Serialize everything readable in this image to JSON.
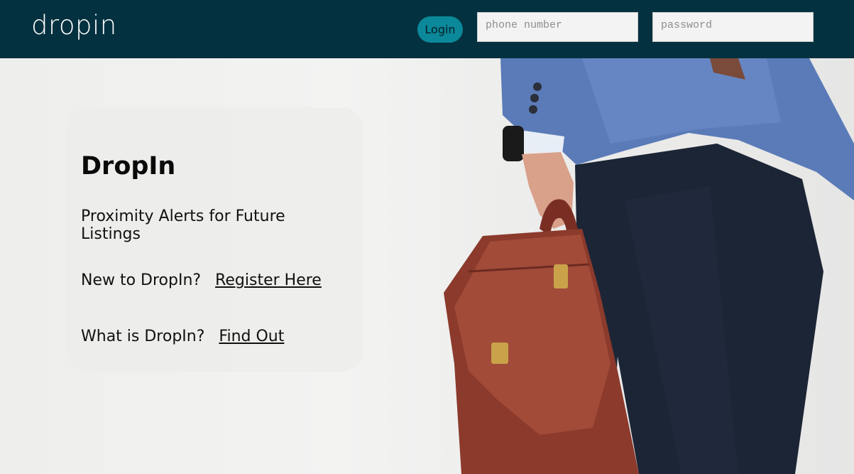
{
  "header": {
    "logo": "dropin",
    "login_label": "Login",
    "phone_placeholder": "phone number",
    "password_placeholder": "password"
  },
  "card": {
    "title": "DropIn",
    "tagline": "Proximity Alerts for Future Listings",
    "register_prompt": "New to DropIn?",
    "register_link": "Register Here",
    "about_prompt": "What is DropIn?",
    "about_link": "Find Out"
  },
  "colors": {
    "header_bg": "#04313f",
    "login_button": "#0b8899"
  }
}
